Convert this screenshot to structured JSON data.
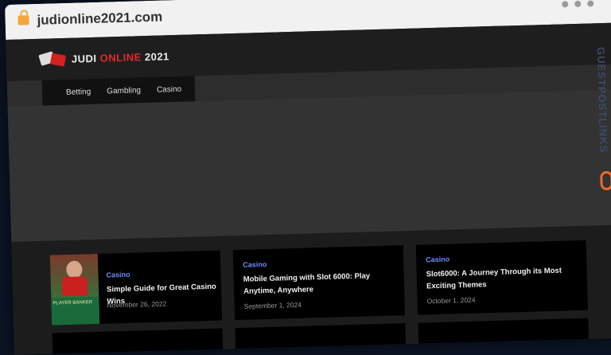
{
  "browser": {
    "url": "judionline2021.com"
  },
  "site": {
    "logo": {
      "part1": "JUDI ",
      "part2": "ONLINE",
      "part3": " 2021"
    },
    "nav": [
      "Betting",
      "Gambling",
      "Casino"
    ]
  },
  "posts": [
    {
      "category": "Casino",
      "title": "Simple Guide for Great Casino Wins",
      "date": "November 26, 2022",
      "thumb_label": "PLAYER    BANKER"
    },
    {
      "category": "Casino",
      "title": "Mobile Gaming with Slot 6000: Play Anytime, Anywhere",
      "date": "September 1, 2024"
    },
    {
      "category": "Casino",
      "title": "Slot6000: A Journey Through its Most Exciting Themes",
      "date": "October 1, 2024"
    }
  ],
  "overlay": {
    "watermark": "GUESTPOSTLINKS"
  }
}
